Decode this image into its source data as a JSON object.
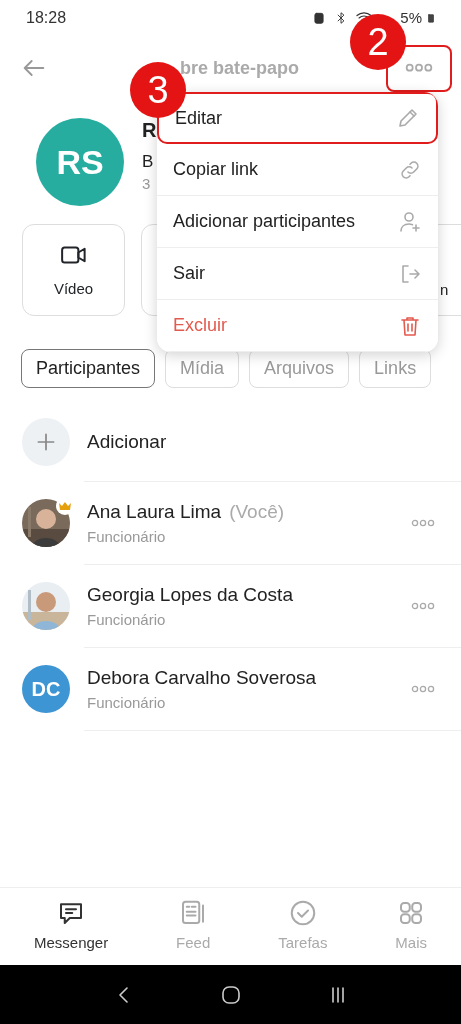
{
  "status_bar": {
    "time": "18:28",
    "battery": "5%"
  },
  "header": {
    "title": "bre bate-papo"
  },
  "profile": {
    "initials": "RS",
    "color": "#26ada0",
    "name": "R",
    "line_2": "B",
    "line_3": "3"
  },
  "actions": [
    {
      "kind": "video",
      "label": "Vídeo"
    },
    {
      "kind": "hidden"
    },
    {
      "kind": "fragment",
      "label": "n"
    }
  ],
  "tabs": [
    {
      "label": "Participantes",
      "selected": true
    },
    {
      "label": "Mídia",
      "selected": false
    },
    {
      "label": "Arquivos",
      "selected": false
    },
    {
      "label": "Links",
      "selected": false
    }
  ],
  "add_row": {
    "label": "Adicionar"
  },
  "members": [
    {
      "name": "Ana Laura Lima",
      "suffix": "(Você)",
      "role": "Funcionário",
      "owner": true
    },
    {
      "name": "Georgia Lopes da Costa",
      "role": "Funcionário",
      "owner": false
    },
    {
      "name": "Debora Carvalho Soverosa",
      "role": "Funcionário",
      "kind": "initials",
      "initials": "DC",
      "color": "#3d95d3",
      "owner": false
    }
  ],
  "menu": {
    "items": [
      {
        "label": "Editar",
        "kind": "edit",
        "danger": false,
        "highlighted": true
      },
      {
        "label": "Copiar link",
        "kind": "link",
        "danger": false,
        "highlighted": false
      },
      {
        "label": "Adicionar participantes",
        "kind": "add-user",
        "danger": false,
        "highlighted": false
      },
      {
        "label": "Sair",
        "kind": "exit",
        "danger": false,
        "highlighted": false
      },
      {
        "label": "Excluir",
        "kind": "delete",
        "danger": true,
        "highlighted": false
      }
    ]
  },
  "more_button": {
    "highlighted": true
  },
  "annotations": [
    {
      "label": "2",
      "kind": "header"
    },
    {
      "label": "3",
      "kind": "menu"
    }
  ],
  "bottom_nav": [
    {
      "label": "Messenger",
      "kind": "chat",
      "selected": true
    },
    {
      "label": "Feed",
      "kind": "feed",
      "selected": false
    },
    {
      "label": "Tarefas",
      "kind": "tasks",
      "selected": false
    },
    {
      "label": "Mais",
      "kind": "more",
      "selected": false
    }
  ]
}
